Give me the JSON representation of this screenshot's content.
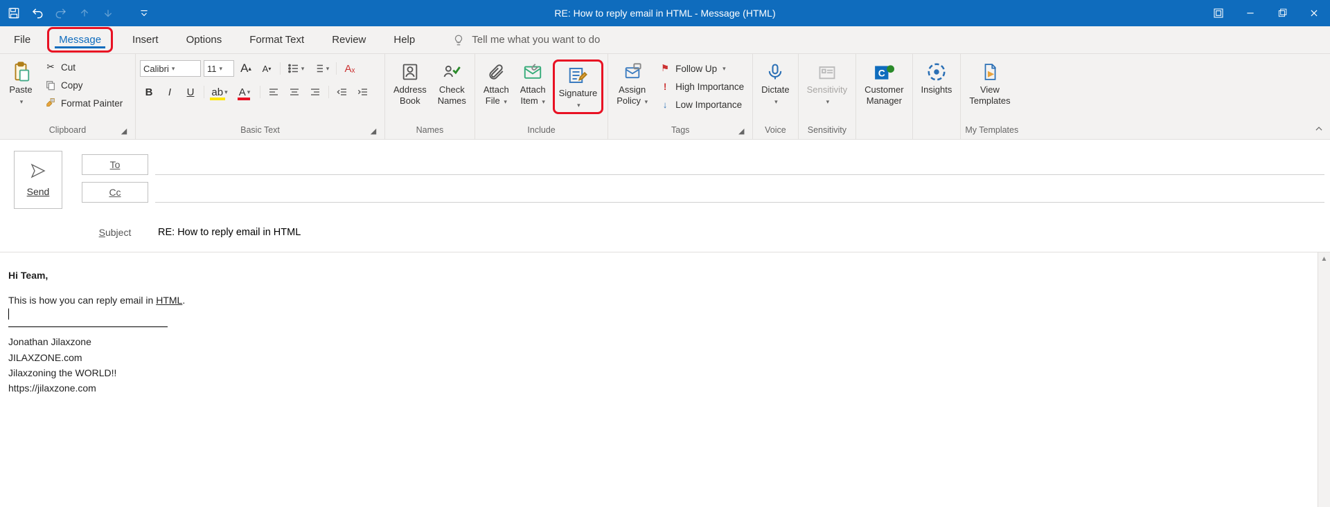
{
  "title": "RE: How to reply email in HTML  -  Message (HTML)",
  "tabs": {
    "file": "File",
    "message": "Message",
    "insert": "Insert",
    "options": "Options",
    "formattext": "Format Text",
    "review": "Review",
    "help": "Help",
    "tellme": "Tell me what you want to do"
  },
  "ribbon": {
    "clipboard": {
      "paste": "Paste",
      "cut": "Cut",
      "copy": "Copy",
      "fmtpainter": "Format Painter",
      "group": "Clipboard"
    },
    "basictext": {
      "font": "Calibri",
      "size": "11",
      "group": "Basic Text"
    },
    "names": {
      "ab": "Address",
      "book": "Book",
      "cn": "Check",
      "names": "Names",
      "group": "Names"
    },
    "include": {
      "af": "Attach",
      "file": "File",
      "ai": "Attach",
      "item": "Item",
      "sig": "Signature",
      "group": "Include"
    },
    "policy": {
      "ap": "Assign",
      "pol": "Policy",
      "group": ""
    },
    "tags": {
      "follow": "Follow Up",
      "hi": "High Importance",
      "lo": "Low Importance",
      "group": "Tags"
    },
    "voice": {
      "dictate": "Dictate",
      "group": "Voice"
    },
    "sens": {
      "sens": "Sensitivity",
      "group": "Sensitivity"
    },
    "cm": {
      "customer": "Customer",
      "manager": "Manager"
    },
    "insights": {
      "ins": "Insights"
    },
    "tpl": {
      "view": "View",
      "tpl": "Templates",
      "group": "My Templates"
    }
  },
  "compose": {
    "send": "Send",
    "to": "To",
    "cc": "Cc",
    "subject_label": "Subject",
    "subject_value": "RE: How to reply email in HTML",
    "to_value": "",
    "cc_value": ""
  },
  "body": {
    "greeting": "Hi Team,",
    "line1_pre": "This is how you can reply email in ",
    "line1_link": "HTML",
    "line1_post": ".",
    "sig1": "Jonathan Jilaxzone",
    "sig2": "JILAXZONE.com",
    "sig3": "Jilaxzoning the WORLD!!",
    "sig4": "https://jilaxzone.com"
  }
}
